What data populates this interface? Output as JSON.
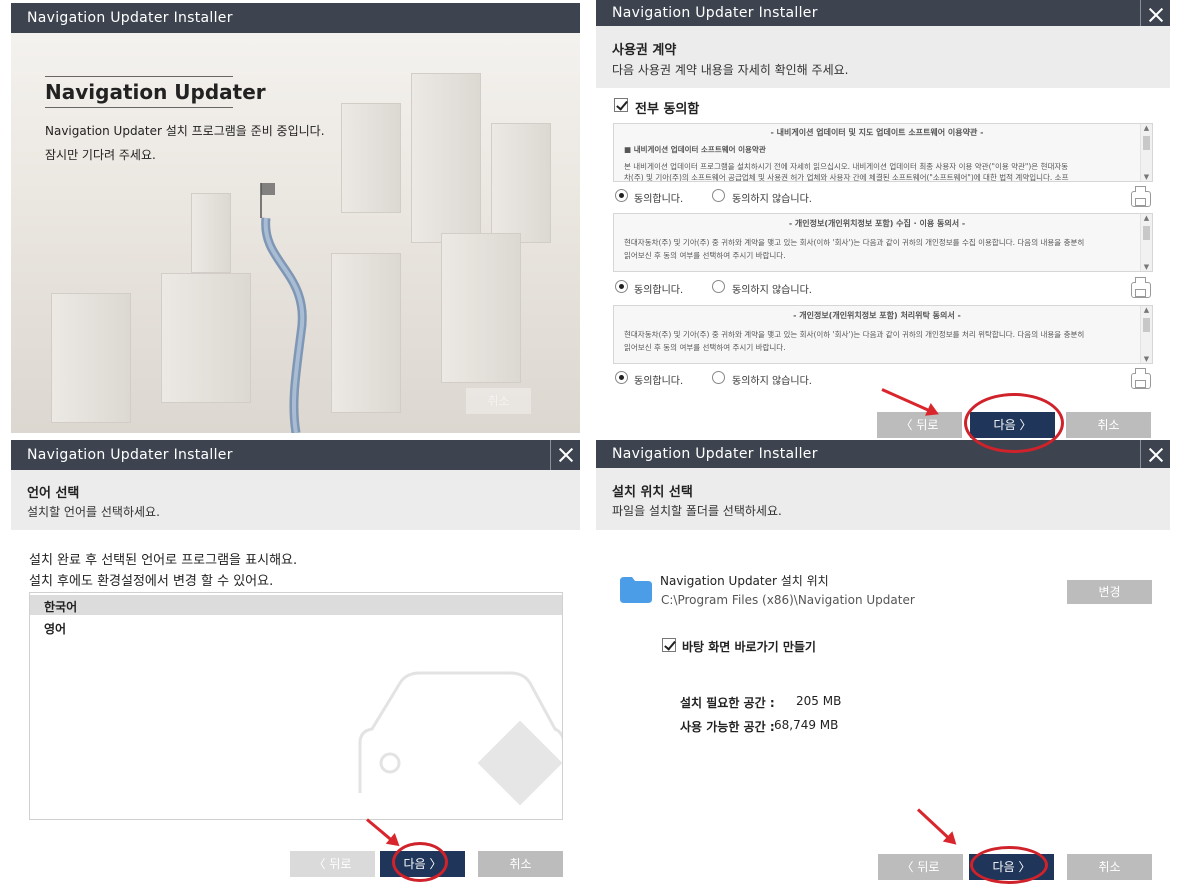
{
  "window_title": "Navigation Updater Installer",
  "splash": {
    "heading": "Navigation Updater",
    "line1": "Navigation Updater 설치 프로그램을 준비 중입니다.",
    "line2": "잠시만 기다려 주세요.",
    "cancel": "취소"
  },
  "license": {
    "title": "사용권 계약",
    "subtitle": "다음 사용권 계약 내용을 자세히 확인해 주세요.",
    "agree_all": "전부 동의함",
    "agree": "동의합니다.",
    "disagree": "동의하지 않습니다.",
    "sections": [
      {
        "heading": "- 내비게이션 업데이터 및 지도 업데이트 소프트웨어 이용약관 -",
        "lines": [
          "■ 내비게이션 업데이터 소프트웨어 이용약관",
          "본 내비게이션 업데이터 프로그램을 설치하시기 전에 자세히 읽으십시오. 내비게이션 업데이터 최종 사용자 이용 약관(\"이용 약관\")은 현대자동",
          "차(주) 및 기아(주)의 소프트웨어 공급업체 및 사용권 허가 업체와 사용자 간에 체결된 소프트웨어(\"소프트웨어\")에 대한 법적 계약입니다. 소프"
        ]
      },
      {
        "heading": "- 개인정보(개인위치정보 포함) 수집 · 이용 동의서 -",
        "lines": [
          "현대자동차(주) 및 기아(주) 중 귀하와 계약을 맺고 있는 회사(이하 '회사')는 다음과 같이 귀하의 개인정보를 수집 이용합니다. 다음의 내용을 충분히",
          "읽어보신 후 동의 여부를 선택하여 주시기 바랍니다."
        ]
      },
      {
        "heading": "- 개인정보(개인위치정보 포함) 처리위탁 동의서 -",
        "lines": [
          "현대자동차(주) 및 기아(주) 중 귀하와 계약을 맺고 있는 회사(이하 '회사')는 다음과 같이 귀하의 개인정보를 처리 위탁합니다. 다음의 내용을 충분히",
          "읽어보신 후 동의 여부를 선택하여 주시기 바랍니다."
        ]
      }
    ],
    "back": "〈 뒤로",
    "next": "다음 〉",
    "cancel": "취소"
  },
  "language": {
    "title": "언어 선택",
    "subtitle": "설치할 언어를 선택하세요.",
    "desc1": "설치 완료 후 선택된 언어로 프로그램을 표시해요.",
    "desc2": "설치 후에도 환경설정에서 변경 할 수 있어요.",
    "options": [
      "한국어",
      "영어"
    ],
    "back": "〈 뒤로",
    "next": "다음 〉",
    "cancel": "취소"
  },
  "location": {
    "title": "설치 위치 선택",
    "subtitle": "파일을 설치할 폴더를 선택하세요.",
    "folder_label": "Navigation Updater 설치 위치",
    "folder_path": "C:\\Program Files (x86)\\Navigation Updater",
    "change": "변경",
    "shortcut": "바탕 화면 바로가기 만들기",
    "required_label": "설치 필요한 공간 :",
    "required_value": "205 MB",
    "available_label": "사용 가능한 공간 :",
    "available_value": "68,749 MB",
    "back": "〈 뒤로",
    "next": "다음 〉",
    "cancel": "취소"
  },
  "colors": {
    "titlebar": "#3d4450",
    "primary_button": "#1f3559",
    "highlight": "#d0222a",
    "folder": "#4a9de6"
  }
}
